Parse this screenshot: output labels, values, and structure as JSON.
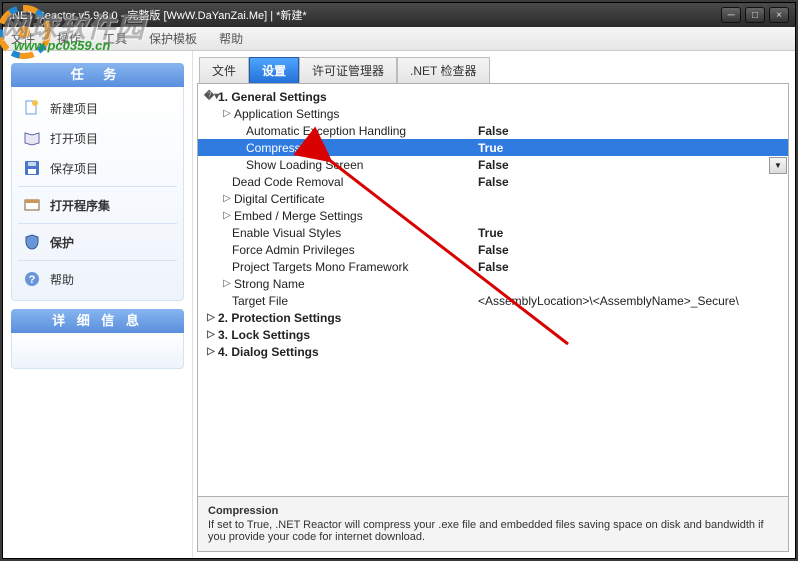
{
  "titlebar": {
    "title": ".NET Reactor v5.9.8.0 - 完整版 [WwW.DaYanZai.Me]  |  *新建*"
  },
  "menu": {
    "file": "文件",
    "operate": "操作",
    "tools": "工具",
    "protect_template": "保护模板",
    "help": "帮助"
  },
  "watermark": {
    "text": "网球软件园",
    "url": "www.pc0359.cn"
  },
  "sidebar": {
    "tasks_header": "任 务",
    "items": [
      {
        "label": "新建项目"
      },
      {
        "label": "打开项目"
      },
      {
        "label": "保存项目"
      },
      {
        "label": "打开程序集"
      },
      {
        "label": "保护"
      },
      {
        "label": "帮助"
      }
    ],
    "details_header": "详 细 信 息"
  },
  "tabs": {
    "items": [
      {
        "label": "文件"
      },
      {
        "label": "设置"
      },
      {
        "label": "许可证管理器"
      },
      {
        "label": ".NET 检查器"
      }
    ],
    "active": 1
  },
  "settings": {
    "sections": {
      "general": "1. General Settings",
      "protection": "2. Protection Settings",
      "lock": "3. Lock Settings",
      "dialog": "4. Dialog Settings"
    },
    "appSettings": "Application Settings",
    "rows": {
      "autoException": {
        "name": "Automatic Exception Handling",
        "value": "False"
      },
      "compression": {
        "name": "Compression",
        "value": "True"
      },
      "showLoading": {
        "name": "Show Loading Screen",
        "value": "False"
      },
      "deadCode": {
        "name": "Dead Code Removal",
        "value": "False"
      },
      "digitalCert": {
        "name": "Digital Certificate"
      },
      "embedMerge": {
        "name": "Embed / Merge Settings"
      },
      "enableVisual": {
        "name": "Enable Visual Styles",
        "value": "True"
      },
      "forceAdmin": {
        "name": "Force Admin Privileges",
        "value": "False"
      },
      "mono": {
        "name": "Project Targets Mono Framework",
        "value": "False"
      },
      "strongName": {
        "name": "Strong Name"
      },
      "targetFile": {
        "name": "Target File",
        "value": "<AssemblyLocation>\\<AssemblyName>_Secure\\"
      }
    }
  },
  "help": {
    "title": "Compression",
    "body": "If set to True, .NET Reactor will compress your .exe file and embedded files saving space on disk and bandwidth if you provide your code for internet download."
  }
}
